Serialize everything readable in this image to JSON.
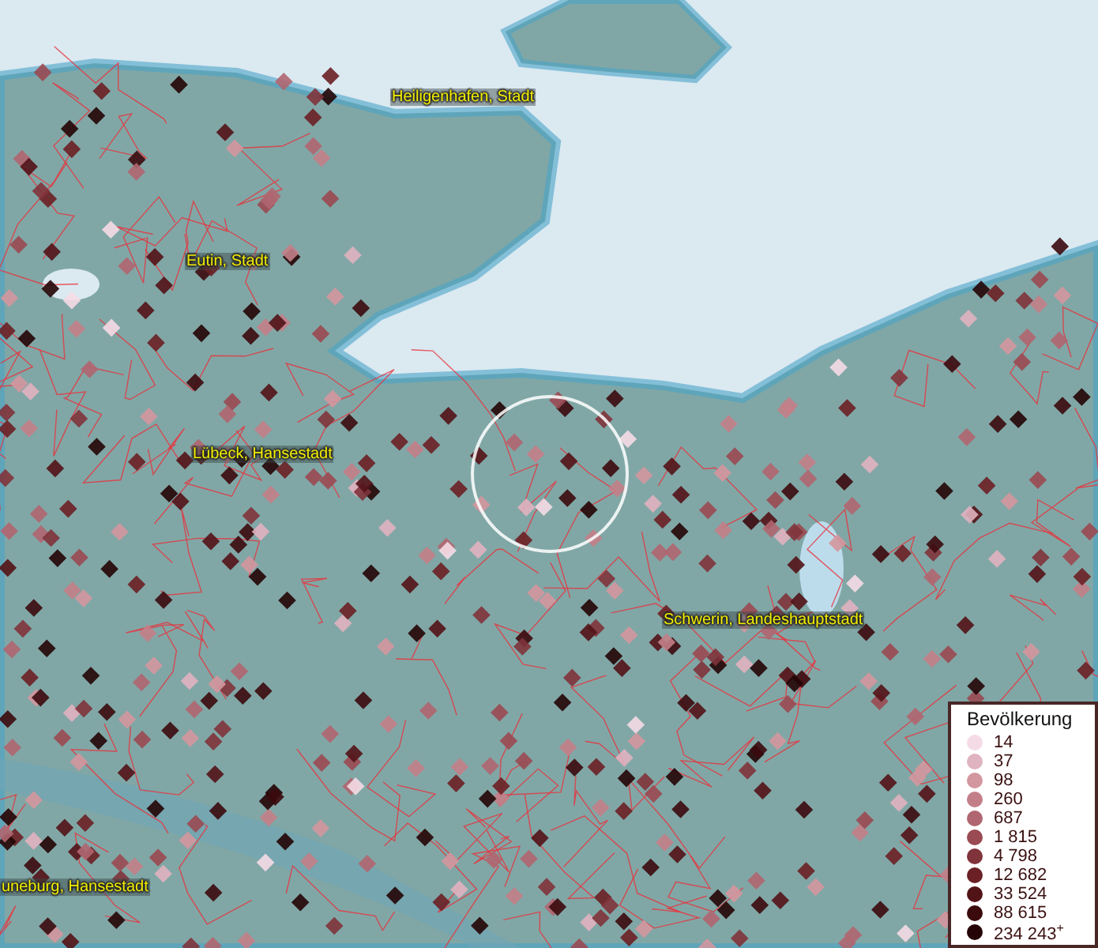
{
  "map": {
    "place_labels": [
      {
        "text": "Heiligenhafen, Stadt"
      },
      {
        "text": "Eutin, Stadt"
      },
      {
        "text": "Lübeck, Hansestadt"
      },
      {
        "text": "Schwerin, Landeshauptstadt"
      },
      {
        "text": "uneburg, Hansestadt"
      }
    ]
  },
  "legend": {
    "title": "Bevölkerung",
    "items": [
      {
        "label": "14",
        "color": "#f5dbe6"
      },
      {
        "label": "37",
        "color": "#e0b3c0"
      },
      {
        "label": "98",
        "color": "#d3979f"
      },
      {
        "label": "260",
        "color": "#c37f88"
      },
      {
        "label": "687",
        "color": "#b06670"
      },
      {
        "label": "1 815",
        "color": "#9a4a52"
      },
      {
        "label": "4 798",
        "color": "#80333b"
      },
      {
        "label": "12 682",
        "color": "#6a2025"
      },
      {
        "label": "33 524",
        "color": "#521317"
      },
      {
        "label": "88 615",
        "color": "#3b0a0d"
      },
      {
        "label": "234 243$^{+}$",
        "color": "#240406"
      }
    ]
  }
}
